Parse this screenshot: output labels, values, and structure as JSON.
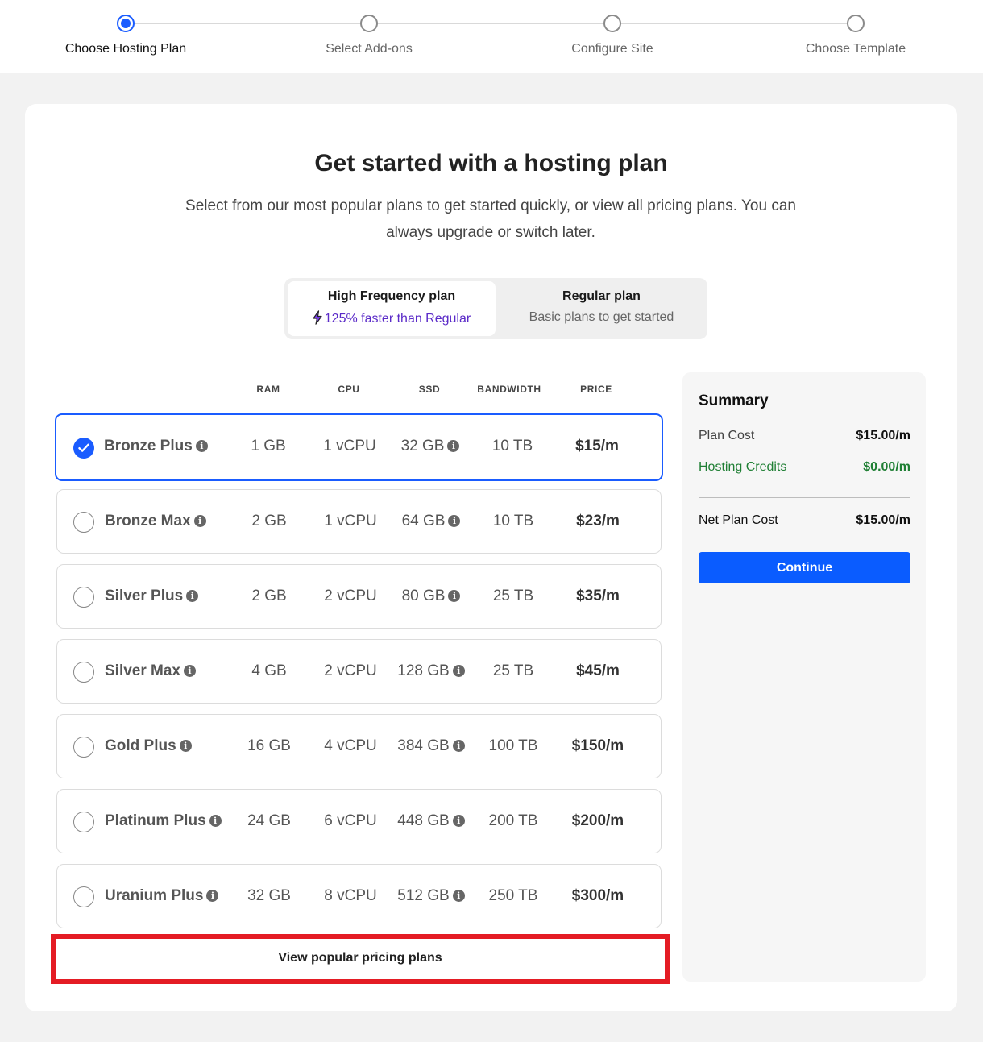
{
  "stepper": {
    "steps": [
      {
        "label": "Choose Hosting Plan",
        "active": true
      },
      {
        "label": "Select Add-ons",
        "active": false
      },
      {
        "label": "Configure Site",
        "active": false
      },
      {
        "label": "Choose Template",
        "active": false
      }
    ]
  },
  "header": {
    "title": "Get started with a hosting plan",
    "subtitle": "Select from our most popular plans to get started quickly, or view all pricing plans. You can always upgrade or switch later."
  },
  "plan_type": {
    "options": [
      {
        "title": "High Frequency plan",
        "subtitle": "125% faster than Regular",
        "selected": true
      },
      {
        "title": "Regular plan",
        "subtitle": "Basic plans to get started",
        "selected": false
      }
    ]
  },
  "table": {
    "columns": [
      "RAM",
      "CPU",
      "SSD",
      "BANDWIDTH",
      "PRICE"
    ],
    "plans": [
      {
        "name": "Bronze Plus",
        "ram": "1 GB",
        "cpu": "1 vCPU",
        "ssd": "32 GB",
        "bandwidth": "10 TB",
        "price": "$15/m",
        "selected": true
      },
      {
        "name": "Bronze Max",
        "ram": "2 GB",
        "cpu": "1 vCPU",
        "ssd": "64 GB",
        "bandwidth": "10 TB",
        "price": "$23/m",
        "selected": false
      },
      {
        "name": "Silver Plus",
        "ram": "2 GB",
        "cpu": "2 vCPU",
        "ssd": "80 GB",
        "bandwidth": "25 TB",
        "price": "$35/m",
        "selected": false
      },
      {
        "name": "Silver Max",
        "ram": "4 GB",
        "cpu": "2 vCPU",
        "ssd": "128 GB",
        "bandwidth": "25 TB",
        "price": "$45/m",
        "selected": false
      },
      {
        "name": "Gold Plus",
        "ram": "16 GB",
        "cpu": "4 vCPU",
        "ssd": "384 GB",
        "bandwidth": "100 TB",
        "price": "$150/m",
        "selected": false
      },
      {
        "name": "Platinum Plus",
        "ram": "24 GB",
        "cpu": "6 vCPU",
        "ssd": "448 GB",
        "bandwidth": "200 TB",
        "price": "$200/m",
        "selected": false
      },
      {
        "name": "Uranium Plus",
        "ram": "32 GB",
        "cpu": "8 vCPU",
        "ssd": "512 GB",
        "bandwidth": "250 TB",
        "price": "$300/m",
        "selected": false
      }
    ],
    "view_link": "View popular pricing plans"
  },
  "summary": {
    "title": "Summary",
    "plan_cost_label": "Plan Cost",
    "plan_cost_value": "$15.00/m",
    "credits_label": "Hosting Credits",
    "credits_value": "$0.00/m",
    "net_label": "Net Plan Cost",
    "net_value": "$15.00/m",
    "continue_label": "Continue"
  },
  "colors": {
    "accent": "#1a5cff",
    "credits_green": "#1f7f34",
    "highlight_border": "#e41c24",
    "purple": "#5b2bc8"
  },
  "icons": [
    "info-icon",
    "check-icon",
    "lightning-bolt-icon"
  ]
}
